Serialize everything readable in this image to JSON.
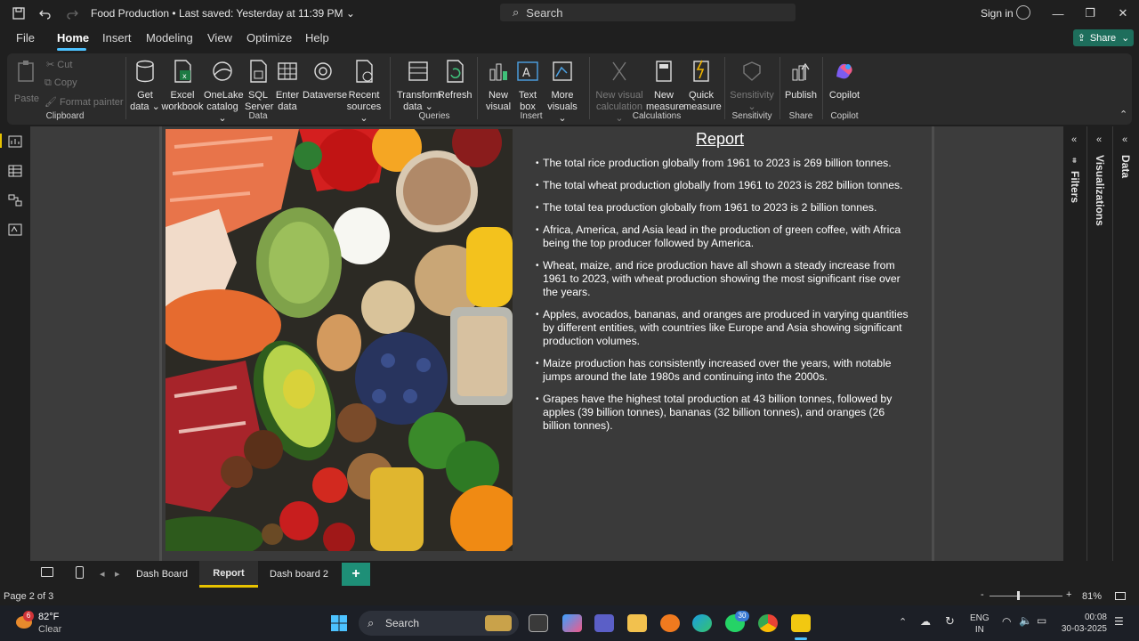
{
  "titlebar": {
    "doc_title": "Food Production",
    "saved_status": "Last saved: Yesterday at 11:39 PM",
    "search_placeholder": "Search",
    "signin_label": "Sign in"
  },
  "menu": {
    "items": [
      "File",
      "Home",
      "Insert",
      "Modeling",
      "View",
      "Optimize",
      "Help"
    ],
    "active": "Home",
    "share_label": "Share"
  },
  "ribbon": {
    "clipboard": {
      "paste": "Paste",
      "cut": "Cut",
      "copy": "Copy",
      "format_painter": "Format painter",
      "group": "Clipboard"
    },
    "data": {
      "buttons": [
        {
          "line1": "Get",
          "line2": "data"
        },
        {
          "line1": "Excel",
          "line2": "workbook"
        },
        {
          "line1": "OneLake",
          "line2": "catalog"
        },
        {
          "line1": "SQL",
          "line2": "Server"
        },
        {
          "line1": "Enter",
          "line2": "data"
        },
        {
          "line1": "Dataverse",
          "line2": ""
        },
        {
          "line1": "Recent",
          "line2": "sources"
        }
      ],
      "group": "Data"
    },
    "queries": {
      "buttons": [
        {
          "line1": "Transform",
          "line2": "data"
        },
        {
          "line1": "Refresh",
          "line2": ""
        }
      ],
      "group": "Queries"
    },
    "insert": {
      "buttons": [
        {
          "line1": "New",
          "line2": "visual"
        },
        {
          "line1": "Text",
          "line2": "box"
        },
        {
          "line1": "More",
          "line2": "visuals"
        }
      ],
      "group": "Insert"
    },
    "calculations": {
      "buttons": [
        {
          "line1": "New visual",
          "line2": "calculation"
        },
        {
          "line1": "New",
          "line2": "measure"
        },
        {
          "line1": "Quick",
          "line2": "measure"
        }
      ],
      "group": "Calculations"
    },
    "sensitivity": {
      "label": "Sensitivity",
      "group": "Sensitivity"
    },
    "share": {
      "label": "Publish",
      "group": "Share"
    },
    "copilot": {
      "label": "Copilot",
      "group": "Copilot"
    }
  },
  "report": {
    "title": "Report",
    "bullets": [
      "The total rice production globally from 1961 to 2023 is 269 billion tonnes.",
      "The total wheat production globally from 1961 to 2023 is 282 billion tonnes.",
      "The total tea production globally from 1961 to 2023 is 2 billion tonnes.",
      "Africa, America, and Asia lead in the production of green coffee, with Africa being the top producer followed by America.",
      "Wheat, maize, and rice production have all shown a steady increase from 1961 to 2023, with wheat production showing the most significant rise over the years.",
      "Apples, avocados, bananas, and oranges are produced in varying quantities by different entities, with countries like Europe and Asia showing significant production volumes.",
      "Maize production has consistently increased over the years, with notable jumps around the late 1980s and continuing into the 2000s.",
      "Grapes have the highest total production at 43 billion tonnes, followed by apples (39 billion tonnes), bananas (32 billion tonnes), and oranges (26 billion tonnes)."
    ]
  },
  "panes": {
    "filters": "Filters",
    "visualizations": "Visualizations",
    "data": "Data"
  },
  "tabs": {
    "items": [
      "Dash Board",
      "Report",
      "Dash board 2"
    ],
    "active": "Report"
  },
  "status": {
    "page": "Page 2 of 3",
    "zoom": "81%"
  },
  "taskbar": {
    "weather_temp": "82°F",
    "weather_cond": "Clear",
    "weather_badge": "6",
    "search": "Search",
    "lang1": "ENG",
    "lang2": "IN",
    "time": "00:08",
    "date": "30-03-2025",
    "whatsapp_badge": "30"
  }
}
